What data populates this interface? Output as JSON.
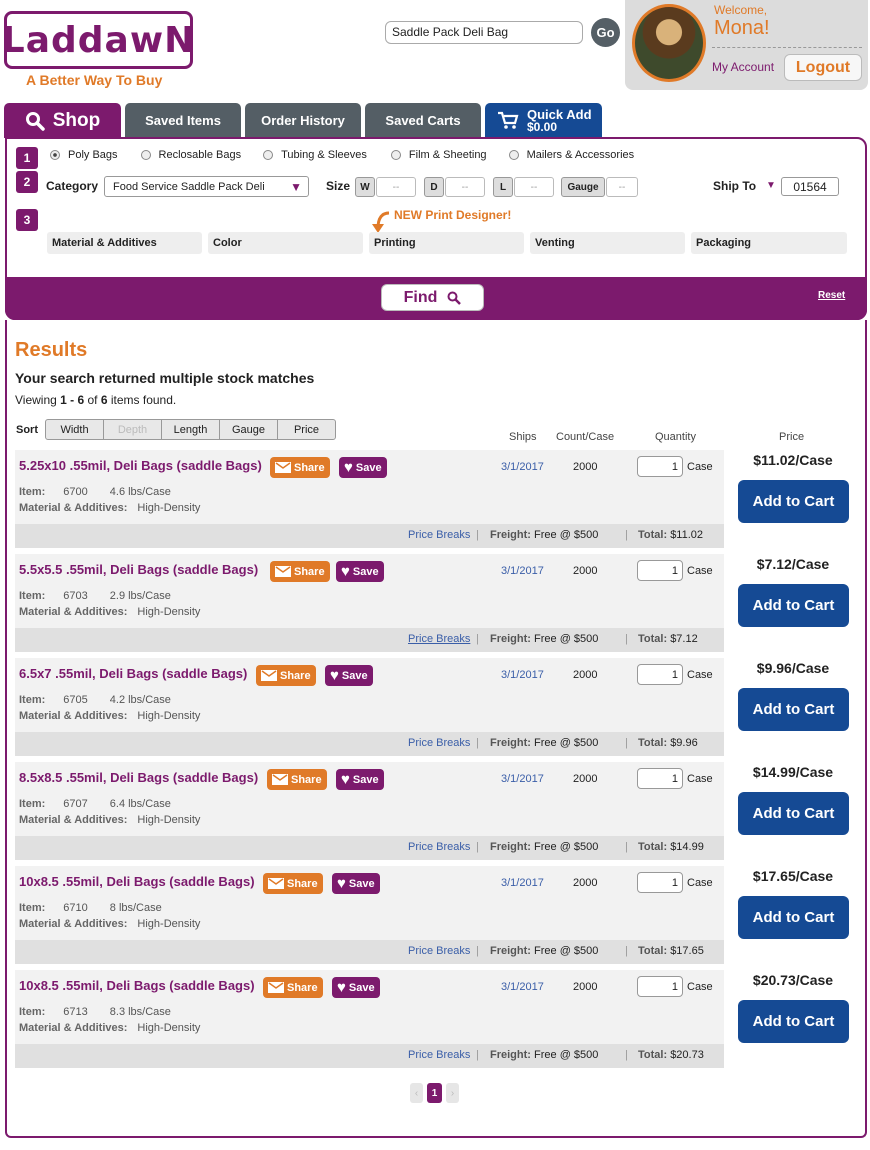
{
  "brand": {
    "logo": "LaddawN",
    "tagline": "A Better Way To Buy"
  },
  "search": {
    "value": "Saddle Pack Deli Bag",
    "go_label": "Go"
  },
  "user": {
    "welcome": "Welcome,",
    "name": "Mona!",
    "my_account": "My Account",
    "logout": "Logout"
  },
  "tabs": [
    {
      "label": "Shop"
    },
    {
      "label": "Saved Items"
    },
    {
      "label": "Order History"
    },
    {
      "label": "Saved Carts"
    },
    {
      "label": "Quick Add",
      "amount": "$0.00"
    }
  ],
  "filters": {
    "steps": [
      "1",
      "2",
      "3"
    ],
    "types": [
      "Poly Bags",
      "Reclosable Bags",
      "Tubing & Sleeves",
      "Film & Sheeting",
      "Mailers & Accessories"
    ],
    "category_label": "Category",
    "category_value": "Food Service Saddle Pack Deli",
    "size_label": "Size",
    "size_w": "W",
    "size_d": "D",
    "size_l": "L",
    "gauge": "Gauge",
    "dash": "--",
    "ship_to_label": "Ship To",
    "ship_to_value": "01564",
    "print_designer": "NEW Print Designer!",
    "attributes": [
      "Material & Additives",
      "Color",
      "Printing",
      "Venting",
      "Packaging"
    ],
    "find_label": "Find",
    "reset_label": "Reset"
  },
  "results": {
    "title": "Results",
    "message": "Your search returned multiple stock matches",
    "viewing_prefix": "Viewing ",
    "viewing_range": "1 - 6",
    "viewing_of": " of ",
    "viewing_total": "6",
    "viewing_suffix": " items found.",
    "sort_label": "Sort",
    "sort_options": [
      "Width",
      "Depth",
      "Length",
      "Gauge",
      "Price"
    ],
    "headers": {
      "ships": "Ships",
      "count": "Count/Case",
      "quantity": "Quantity",
      "price": "Price"
    },
    "labels": {
      "item": "Item:",
      "material": "Material & Additives:",
      "share": "Share",
      "save": "Save",
      "case": "Case",
      "price_breaks": "Price Breaks",
      "freight": "Freight:",
      "freight_value": "Free @ $500",
      "total": "Total:",
      "add_to_cart": "Add to Cart"
    },
    "items": [
      {
        "title": "5.25x10 .55mil, Deli Bags (saddle Bags)",
        "item": "6700",
        "weight": "4.6 lbs/Case",
        "material": "High-Density",
        "ships": "3/1/2017",
        "count": "2000",
        "qty": "1",
        "total": "$11.02",
        "price": "$11.02/Case"
      },
      {
        "title": "5.5x5.5 .55mil, Deli Bags (saddle Bags)",
        "item": "6703",
        "weight": "2.9 lbs/Case",
        "material": "High-Density",
        "ships": "3/1/2017",
        "count": "2000",
        "qty": "1",
        "total": "$7.12",
        "price": "$7.12/Case"
      },
      {
        "title": "6.5x7 .55mil, Deli Bags (saddle Bags)",
        "item": "6705",
        "weight": "4.2 lbs/Case",
        "material": "High-Density",
        "ships": "3/1/2017",
        "count": "2000",
        "qty": "1",
        "total": "$9.96",
        "price": "$9.96/Case"
      },
      {
        "title": "8.5x8.5 .55mil, Deli Bags (saddle Bags)",
        "item": "6707",
        "weight": "6.4 lbs/Case",
        "material": "High-Density",
        "ships": "3/1/2017",
        "count": "2000",
        "qty": "1",
        "total": "$14.99",
        "price": "$14.99/Case"
      },
      {
        "title": "10x8.5 .55mil, Deli Bags (saddle Bags)",
        "item": "6710",
        "weight": "8 lbs/Case",
        "material": "High-Density",
        "ships": "3/1/2017",
        "count": "2000",
        "qty": "1",
        "total": "$17.65",
        "price": "$17.65/Case"
      },
      {
        "title": "10x8.5 .55mil, Deli Bags (saddle Bags)",
        "item": "6713",
        "weight": "8.3 lbs/Case",
        "material": "High-Density",
        "ships": "3/1/2017",
        "count": "2000",
        "qty": "1",
        "total": "$20.73",
        "price": "$20.73/Case"
      }
    ],
    "pager": {
      "prev": "‹",
      "current": "1",
      "next": "›"
    }
  },
  "colors": {
    "brand_purple": "#7c1a6d",
    "accent_orange": "#e07a28",
    "cart_blue": "#154a94"
  }
}
